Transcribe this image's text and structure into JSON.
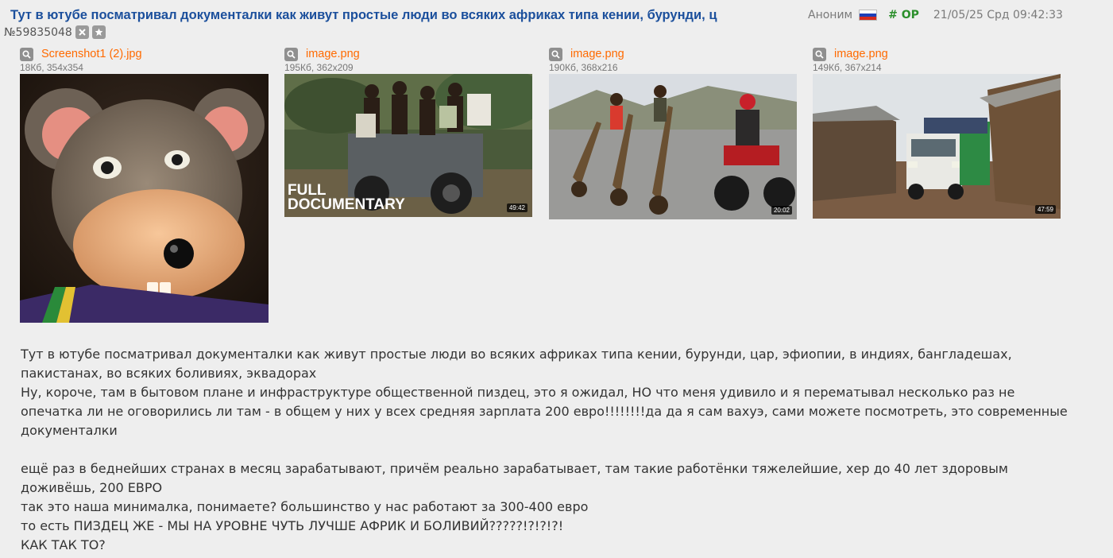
{
  "post": {
    "subject": "Тут в ютубе посматривал документалки как живут простые люди во всяких африках типа кении, бурунди, ц",
    "author": "Аноним",
    "op_label": "# OP",
    "date": "21/05/25 Срд 09:42:33",
    "number": "№59835048",
    "flag_colors": [
      "#ffffff",
      "#1c3fb8",
      "#d52b1e"
    ]
  },
  "files": [
    {
      "name": "Screenshot1 (2).jpg",
      "meta": "18Кб, 354x354",
      "duration": ""
    },
    {
      "name": "image.png",
      "meta": "195Кб, 362x209",
      "duration": "49:42",
      "overlay": "FULL\nDOCUMENTARY"
    },
    {
      "name": "image.png",
      "meta": "190Кб, 368x216",
      "duration": "20:02"
    },
    {
      "name": "image.png",
      "meta": "149Кб, 367x214",
      "duration": "47:59"
    }
  ],
  "body": {
    "lines": [
      "Тут в ютубе посматривал документалки как живут простые люди во всяких африках типа кении, бурунди, цар, эфиопии, в индиях, бангладешах,",
      "пакистанах, во всяких боливиях, эквадорах",
      "Ну, короче, там в бытовом плане и инфраструктуре общественной пиздец, это я ожидал, НО что меня удивило и я перематывал несколько раз не",
      "опечатка ли не оговорились ли там - в общем у них у всех средняя зарплата 200 евро!!!!!!!!да да я сам вахуэ, сами можете посмотреть, это современные",
      "документалки",
      "",
      "ещё раз в беднейших странах в месяц зарабатывают, причём реально зарабатывает, там такие работёнки тяжелейшие, хер до 40 лет здоровым",
      "доживёшь, 200 ЕВРО",
      "так это наша минималка, понимаете? большинство у нас работают за 300-400 евро",
      "то есть ПИЗДЕЦ ЖЕ - МЫ НА УРОВНЕ ЧУТЬ ЛУЧШЕ АФРИК И БОЛИВИЙ?????!?!?!?!",
      "КАК ТАК ТО?"
    ]
  },
  "colors": {
    "subject": "#1b4f9c",
    "filename": "#ff6a00",
    "op": "#2b8f2b",
    "background": "#eeeeee"
  }
}
